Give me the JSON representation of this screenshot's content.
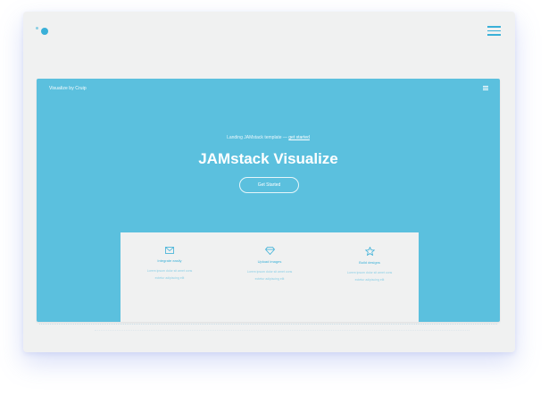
{
  "site": {
    "logo_icon": "dots-logo-icon",
    "menu_icon": "hamburger-icon"
  },
  "preview": {
    "nav_brand": "Visualize by Cruip",
    "nav_menu_icon": "hamburger-icon",
    "tagline": "Landing JAMstack template",
    "tagline_link": "get started",
    "title": "JAMstack Visualize",
    "cta_label": "Get Started",
    "accent": "#5bc0de",
    "features": [
      {
        "icon": "envelope-icon",
        "title": "Integrate easily",
        "line1": "Lorem ipsum dolor sit amet cons",
        "line2": "ectetur adipiscing elit"
      },
      {
        "icon": "diamond-icon",
        "title": "Upload images",
        "line1": "Lorem ipsum dolor sit amet cons",
        "line2": "ectetur adipiscing elit"
      },
      {
        "icon": "star-icon",
        "title": "Build designs",
        "line1": "Lorem ipsum dolor sit amet cons",
        "line2": "ectetur adipiscing elit"
      }
    ]
  }
}
